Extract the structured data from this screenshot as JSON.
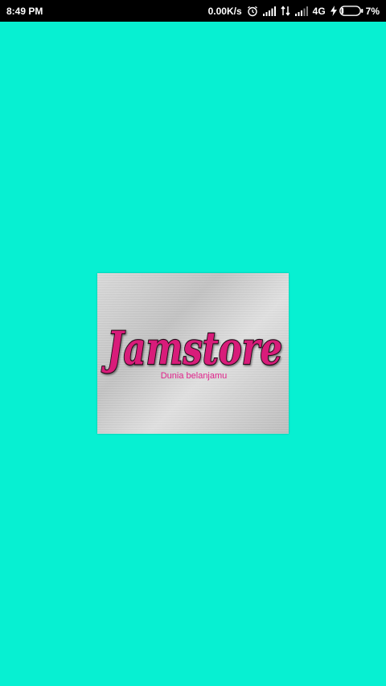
{
  "status_bar": {
    "time": "8:49 PM",
    "network_speed": "0.00K/s",
    "network_type": "4G",
    "battery": "7%",
    "icons": [
      "alarm-icon",
      "signal-icon",
      "data-arrows-icon",
      "signal-icon",
      "charging-icon",
      "battery-icon"
    ]
  },
  "splash": {
    "background_color": "#07F0D2",
    "logo": {
      "brand": "Jamstore",
      "tagline": "Dunia belanjamu",
      "brand_color": "#D81B7A",
      "tagline_color": "#E0218A"
    }
  }
}
